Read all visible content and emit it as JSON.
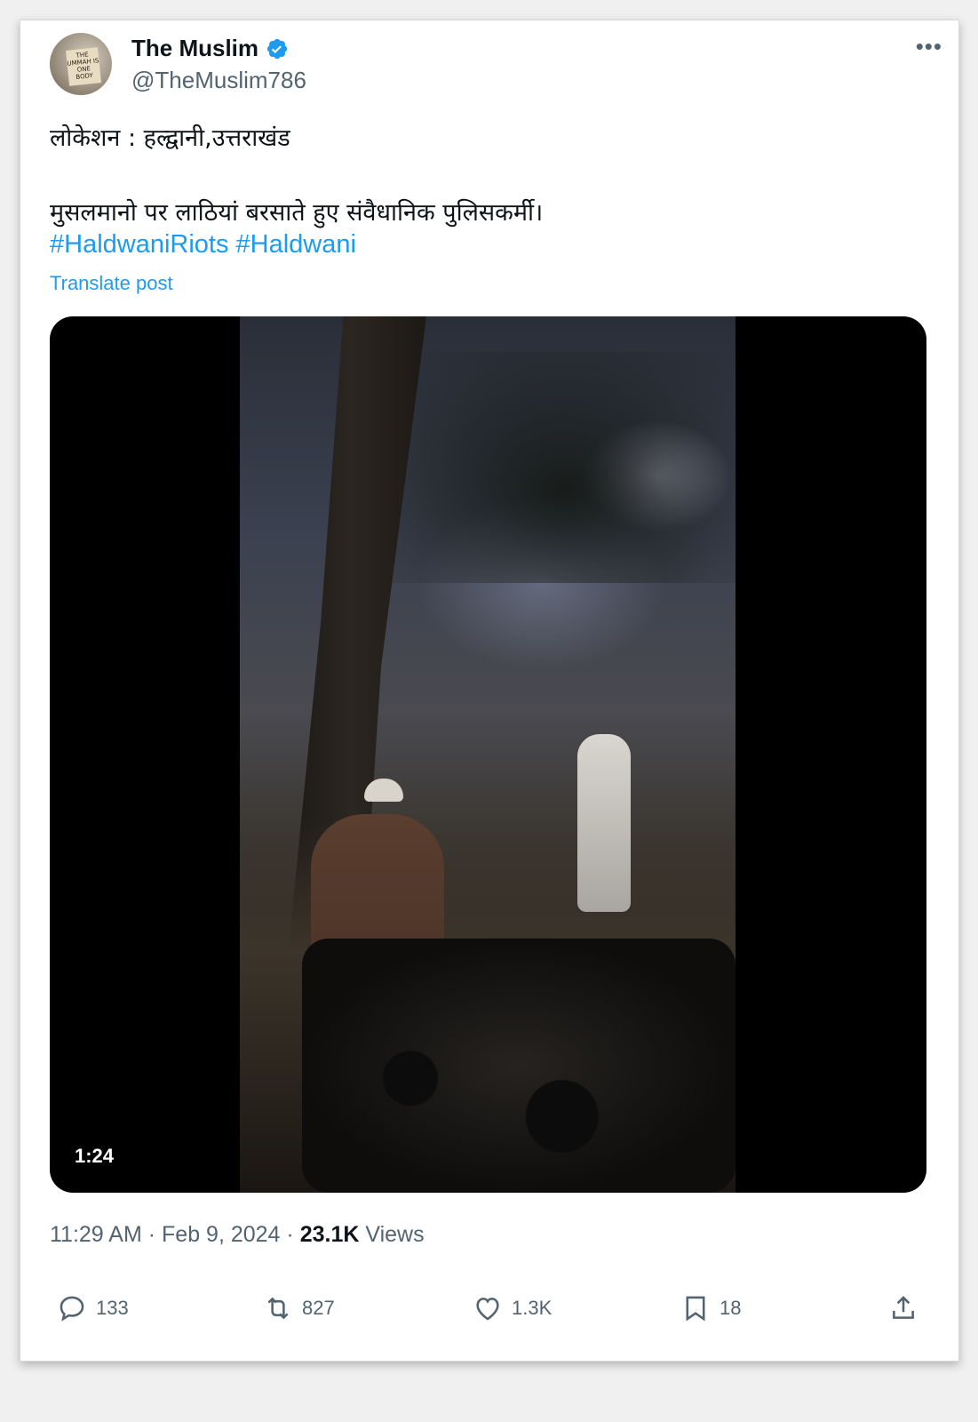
{
  "author": {
    "display_name": "The Muslim",
    "handle": "@TheMuslim786",
    "avatar_sign_text": "THE UMMAH IS ONE BODY"
  },
  "post": {
    "line1": "लोकेशन : हल्द्वानी,उत्तराखंड",
    "line2": "मुसलमानो पर लाठियां बरसाते हुए संवैधानिक पुलिसकर्मी।",
    "hashtags": [
      "#HaldwaniRiots",
      "#Haldwani"
    ],
    "translate_label": "Translate post"
  },
  "media": {
    "duration": "1:24"
  },
  "meta": {
    "time": "11:29 AM",
    "separator": "·",
    "date": "Feb 9, 2024",
    "views_count": "23.1K",
    "views_label": "Views"
  },
  "actions": {
    "replies": "133",
    "reposts": "827",
    "likes": "1.3K",
    "bookmarks": "18"
  },
  "colors": {
    "link": "#1d9bf0",
    "muted": "#536471",
    "text": "#0f1419"
  }
}
